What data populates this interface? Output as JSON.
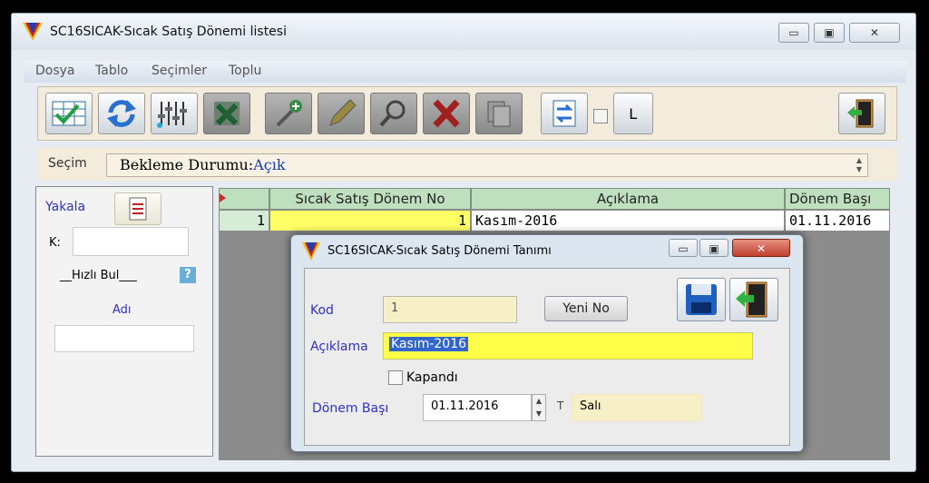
{
  "window": {
    "title": "SC16SICAK-Sıcak Satış Dönemi listesi",
    "minimize": "▭",
    "maximize": "▣",
    "close": "✕"
  },
  "menu": [
    "Dosya",
    "Tablo",
    "Seçimler",
    "Toplu"
  ],
  "toolbar": {
    "l_label": "L",
    "icons": [
      "grid-check-icon",
      "refresh-icon",
      "equalizer-icon",
      "excel-icon",
      "add-icon",
      "edit-icon",
      "search-icon",
      "delete-icon",
      "copy-icon",
      "transfer-icon",
      "exit-door-icon"
    ]
  },
  "secim": {
    "label": "Seçim",
    "value_prefix": "Bekleme Durumu:",
    "value_state": "Açık"
  },
  "left_panel": {
    "yakala": "Yakala",
    "k_label": "K:",
    "hizli_bul": "__Hızlı Bul___",
    "help": "?",
    "adi": "Adı"
  },
  "grid": {
    "columns": [
      "Sıcak Satış Dönem No",
      "Açıklama",
      "Dönem Başı"
    ],
    "rows": [
      {
        "row_no": "1",
        "no": "1",
        "aciklama": "Kasım-2016",
        "donem_basi": "01.11.2016"
      }
    ]
  },
  "dialog": {
    "title": "SC16SICAK-Sıcak Satış Dönemi Tanımı",
    "kod_label": "Kod",
    "kod_value": "1",
    "yeni_no": "Yeni No",
    "aciklama_label": "Açıklama",
    "aciklama_value": "Kasım-2016",
    "kapandi_label": "Kapandı",
    "donem_basi_label": "Dönem Başı",
    "donem_basi_value": "01.11.2016",
    "t_label": "T",
    "gun_value": "Salı"
  },
  "colors": {
    "highlight_yellow": "#ffff66",
    "header_green": "#bfe0bf",
    "field_beige": "#f7efc6"
  }
}
